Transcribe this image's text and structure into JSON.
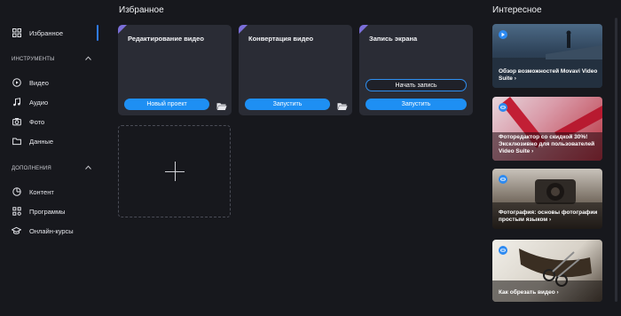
{
  "sidebar": {
    "favorites": "Избранное",
    "tools_header": "ИНСТРУМЕНТЫ",
    "tools": [
      {
        "label": "Видео",
        "icon": "play-icon"
      },
      {
        "label": "Аудио",
        "icon": "music-note-icon"
      },
      {
        "label": "Фото",
        "icon": "camera-icon"
      },
      {
        "label": "Данные",
        "icon": "folder-icon"
      }
    ],
    "addons_header": "ДОПОЛНЕНИЯ",
    "addons": [
      {
        "label": "Контент",
        "icon": "pie-chart-icon"
      },
      {
        "label": "Программы",
        "icon": "apps-grid-icon"
      },
      {
        "label": "Онлайн-курсы",
        "icon": "graduation-cap-icon"
      }
    ]
  },
  "favorites": {
    "title": "Избранное",
    "cards": [
      {
        "title": "Редактирование видео",
        "button": "Новый проект"
      },
      {
        "title": "Конвертация видео",
        "button": "Запустить"
      },
      {
        "title": "Запись экрана",
        "secondary_button": "Начать запись",
        "button": "Запустить"
      }
    ]
  },
  "interesting": {
    "title": "Интересное",
    "items": [
      {
        "text": "Обзор возможностей Movavi Video Suite ›",
        "badge": "play-icon"
      },
      {
        "text": "Фоторедактор со скидкой 30%! Эксклюзивно для пользователей Video Suite ›",
        "badge": "link-icon"
      },
      {
        "text": "Фотография: основы фотографии простым языком ›",
        "badge": "link-icon"
      },
      {
        "text": "Как обрезать видео ›",
        "badge": "link-icon"
      }
    ]
  },
  "colors": {
    "accent": "#1e8ff3",
    "card": "#2a2c35",
    "background": "#17181d",
    "corner": "#7b6fd9"
  }
}
